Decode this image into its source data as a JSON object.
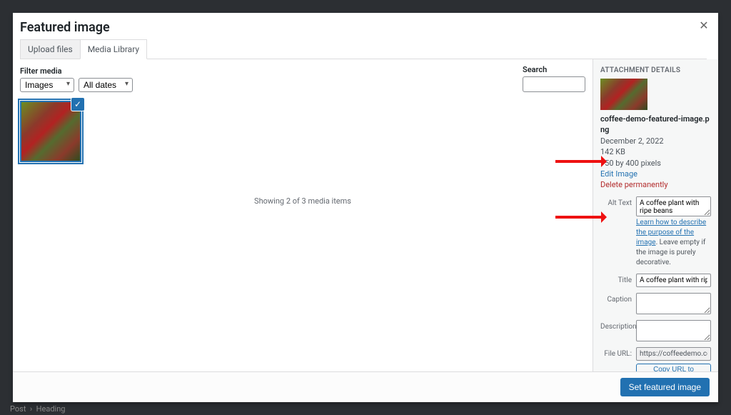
{
  "modal": {
    "title": "Featured image",
    "tabs": {
      "upload": "Upload files",
      "library": "Media Library"
    },
    "close_glyph": "✕"
  },
  "toolbar": {
    "filter_label": "Filter media",
    "type_select": "Images",
    "date_select": "All dates",
    "search_label": "Search"
  },
  "grid": {
    "status": "Showing 2 of 3 media items",
    "check_glyph": "✓"
  },
  "attachment": {
    "heading": "ATTACHMENT DETAILS",
    "filename": "coffee-demo-featured-image.png",
    "date": "December 2, 2022",
    "filesize": "142 KB",
    "dimensions": "750 by 400 pixels",
    "edit_link": "Edit Image",
    "delete_link": "Delete permanently",
    "labels": {
      "alt": "Alt Text",
      "title": "Title",
      "caption": "Caption",
      "description": "Description",
      "file_url": "File URL:"
    },
    "alt_value": "A coffee plant with ripe beans",
    "alt_help_link": "Learn how to describe the purpose of the image",
    "alt_help_text": ". Leave empty if the image is purely decorative.",
    "title_value": "A coffee plant with ripe be",
    "file_url_value": "https://coffeedemo.com/w",
    "copy_btn": "Copy URL to clipboard"
  },
  "footer": {
    "submit": "Set featured image"
  },
  "breadcrumb": {
    "post": "Post",
    "sep": "›",
    "heading": "Heading"
  }
}
